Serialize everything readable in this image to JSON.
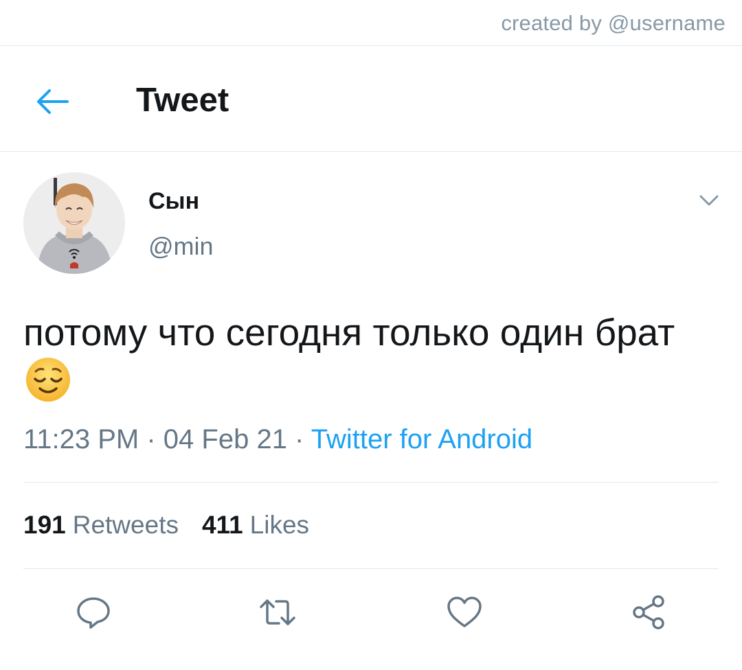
{
  "watermark": "created by @username",
  "header": {
    "title": "Tweet",
    "back_icon": "arrow-left-icon"
  },
  "author": {
    "name": "Сын",
    "handle": "@min",
    "avatar": "profile-photo"
  },
  "tweet": {
    "text": "потому что сегодня только один брат",
    "emoji": "relieved-face-emoji",
    "time": "11:23 PM",
    "date": "04 Feb 21",
    "separator": " · ",
    "source": "Twitter for Android"
  },
  "stats": {
    "retweets": {
      "count": "191",
      "label": "Retweets"
    },
    "likes": {
      "count": "411",
      "label": "Likes"
    }
  },
  "actions": [
    "reply-icon",
    "retweet-icon",
    "like-icon",
    "share-icon"
  ],
  "colors": {
    "accent": "#1da1f2",
    "secondary_text": "#657786",
    "divider": "#e1e8ed"
  }
}
